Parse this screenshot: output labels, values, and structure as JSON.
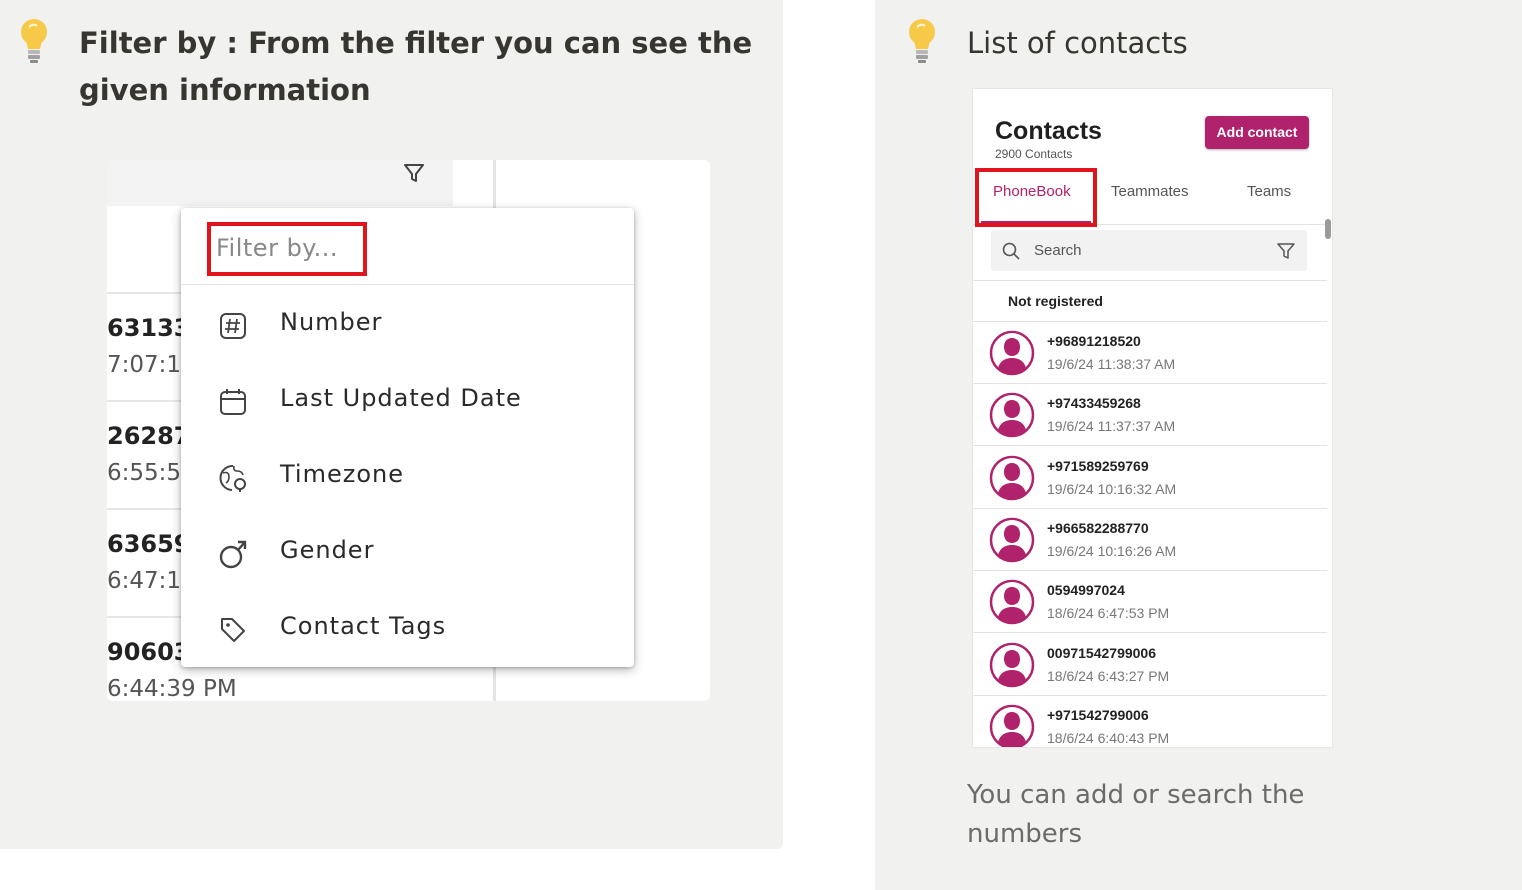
{
  "left_callout": {
    "heading": "Filter by : From the filter you can see the given information",
    "background_rows": [
      {
        "number": "63133",
        "time": "7:07:1"
      },
      {
        "number": "26287",
        "time": "6:55:5"
      },
      {
        "number": "63659",
        "time": "6:47:1"
      },
      {
        "number": "90603",
        "time": "6:44:39 PM"
      }
    ],
    "filter_menu": {
      "placeholder": "Filter by...",
      "items": [
        {
          "label": "Number",
          "icon": "hash-icon"
        },
        {
          "label": "Last Updated Date",
          "icon": "calendar-icon"
        },
        {
          "label": "Timezone",
          "icon": "globe-clock-icon"
        },
        {
          "label": "Gender",
          "icon": "gender-icon"
        },
        {
          "label": "Contact Tags",
          "icon": "tag-icon"
        }
      ]
    }
  },
  "right_callout": {
    "heading": "List of contacts",
    "note": "You can add or search the numbers",
    "app": {
      "title": "Contacts",
      "count": "2900 Contacts",
      "add_button": "Add contact",
      "tabs": [
        "PhoneBook",
        "Teammates",
        "Teams"
      ],
      "active_tab": "PhoneBook",
      "search_placeholder": "Search",
      "section_label": "Not registered",
      "contacts": [
        {
          "number": "+96891218520",
          "date": "19/6/24 11:38:37 AM"
        },
        {
          "number": "+97433459268",
          "date": "19/6/24 11:37:37 AM"
        },
        {
          "number": "+971589259769",
          "date": "19/6/24 10:16:32 AM"
        },
        {
          "number": "+966582288770",
          "date": "19/6/24 10:16:26 AM"
        },
        {
          "number": "0594997024",
          "date": "18/6/24 6:47:53 PM"
        },
        {
          "number": "00971542799006",
          "date": "18/6/24 6:43:27 PM"
        },
        {
          "number": "+971542799006",
          "date": "18/6/24 6:40:43 PM"
        }
      ]
    }
  },
  "colors": {
    "brand": "#b0226b",
    "highlight": "#e0141d",
    "callout_bg": "#f1f1ef"
  }
}
